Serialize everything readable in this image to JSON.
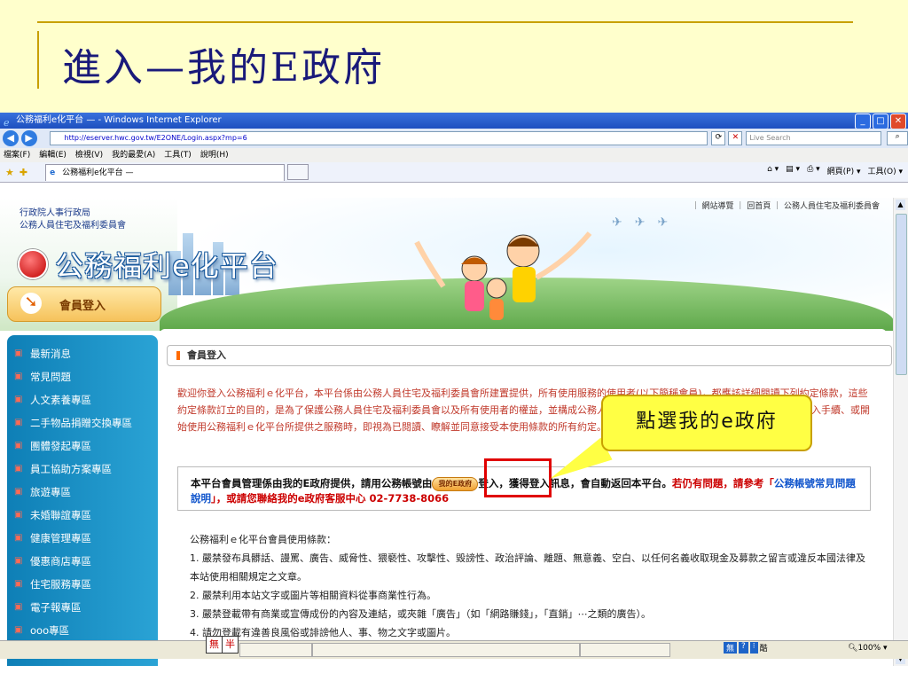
{
  "slide": {
    "title": "進入—我的E政府"
  },
  "window": {
    "title": "公務福利e化平台 — - Windows Internet Explorer",
    "address": "http://eserver.hwc.gov.tw/E2ONE/Login.aspx?mp=6",
    "search_placeholder": "Live Search",
    "menu": [
      "檔案(F)",
      "編輯(E)",
      "檢視(V)",
      "我的最愛(A)",
      "工具(T)",
      "說明(H)"
    ],
    "tab_label": "公務福利e化平台 —",
    "cmd": {
      "home": "⌂ ▾",
      "feed": "▤ ▾",
      "print": "⎙ ▾",
      "page": "網頁(P) ▾",
      "tools": "工具(O) ▾"
    }
  },
  "site": {
    "toplinks": "｜ 網站導覽 ｜ 回首頁 ｜ 公務人員住宅及福利委員會",
    "org_line1": "行政院人事行政局",
    "org_line2": "公務人員住宅及福利委員會",
    "brand": "公務福利e化平台",
    "member_login_button": "會員登入",
    "sidebar": [
      "最新消息",
      "常見問題",
      "人文素養專區",
      "二手物品捐贈交換專區",
      "團體發起專區",
      "員工協助方案專區",
      "旅遊專區",
      "未婚聯誼專區",
      "健康管理專區",
      "優惠商店專區",
      "住宅服務專區",
      "電子報專區",
      "ooo專區"
    ],
    "section_title": "會員登入",
    "intro": "歡迎你登入公務福利ｅ化平台，本平台係由公務人員住宅及福利委員會所建置提供，所有使用服務的使用者(以下簡稱會員)，都應該詳細閱讀下列約定條款，這些約定條款訂立的目的，是為了保護公務人員住宅及福利委員會以及所有使用者的權益，並構成公務人員住宅及福利委員會之間的契約，使用者完成登入手續、或開始使用公務福利ｅ化平台所提供之服務時，即視為已閱讀、瞭解並同意接受本使用條款的所有約定。",
    "notice_part1": "本平台會員管理係由我的E政府提供，請用公務帳號由",
    "myegov_button": "我的E政府",
    "notice_part2": "登入，獲得登入訊息，會自動返回本平台。",
    "notice_red1": "若仍有問題，請參考「",
    "notice_link": "公務帳號常見問題說明",
    "notice_red2": "」，或請您聯絡我的e政府客服中心 02-7738-8066",
    "terms_title": "公務福利ｅ化平台會員使用條款：",
    "terms": [
      "1. 嚴禁發布具髒話、謾罵、廣告、威脅性、猥褻性、攻擊性、毀謗性、政治評論、離題、無意義、空白、以任何名義收取現金及募款之留言或違反本國法律及本站使用相關規定之文章。",
      "2. 嚴禁利用本站文字或圖片等相關資料從事商業性行為。",
      "3. 嚴禁登載帶有商業或宣傳成份的內容及連結，或夾雜「廣告」（如「網路賺錢」，「直銷」⋯之類的廣告）。",
      "4. 請勿登載有違善良風俗或誹謗他人、事、物之文字或圖片。"
    ]
  },
  "callout": "點選我的e政府",
  "statusbar": {
    "ime_left": [
      "無",
      "半"
    ],
    "ime_right": [
      "無",
      "?",
      "⁝"
    ],
    "ime_right_text": "酷",
    "zoom": "100%"
  }
}
